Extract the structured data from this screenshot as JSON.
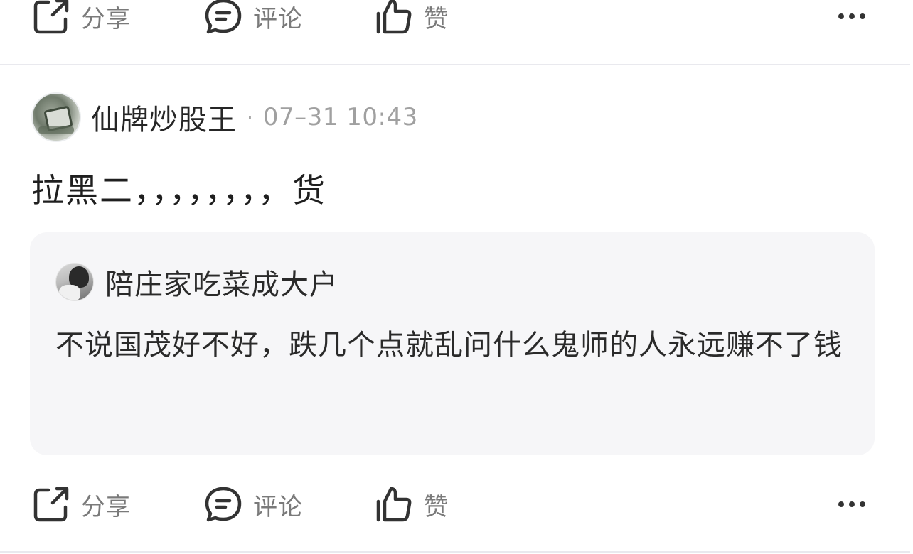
{
  "top_actions": {
    "share_label": "分享",
    "comment_label": "评论",
    "like_label": "赞"
  },
  "post": {
    "username": "仙牌炒股王",
    "separator": "·",
    "timestamp": "07–31 10:43",
    "body": "拉黑二，，，，，，，，货",
    "quote": {
      "username": "陪庄家吃菜成大户",
      "text": "不说国茂好不好，跌几个点就乱问什么鬼师的人永远赚不了钱"
    }
  },
  "bottom_actions": {
    "share_label": "分享",
    "comment_label": "评论",
    "like_label": "赞"
  },
  "icons": {
    "share": "share-icon",
    "comment": "comment-icon",
    "like": "thumbs-up-icon",
    "more": "more-horizontal-icon"
  },
  "colors": {
    "text_primary": "#1f1f1f",
    "text_secondary": "#7a7a7a",
    "timestamp": "#a0a0a0",
    "quote_bg": "#f6f6f8",
    "divider": "#e9e9ee"
  }
}
